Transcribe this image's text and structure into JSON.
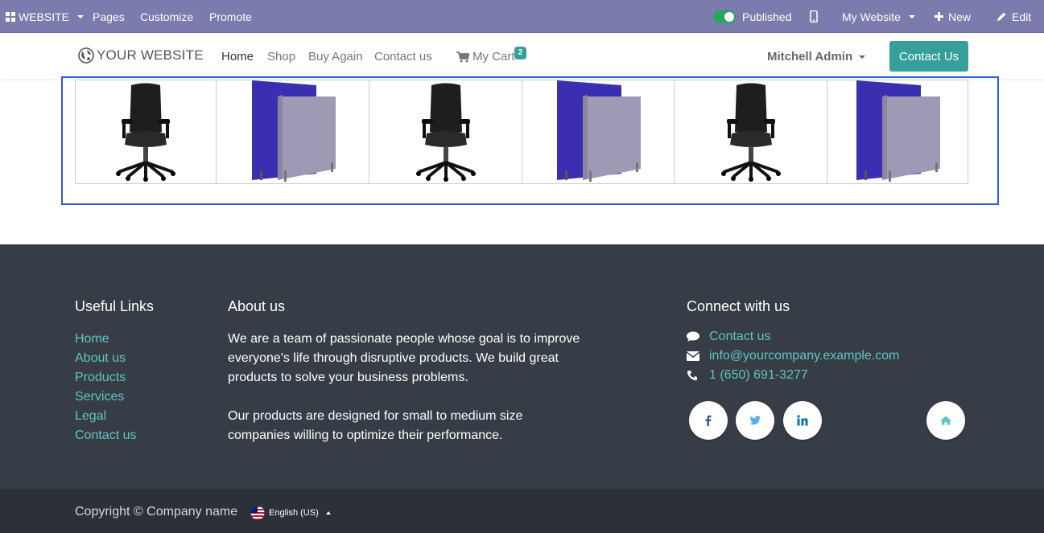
{
  "admin_bar": {
    "app_menu_label": "WEBSITE",
    "items": [
      "Pages",
      "Customize",
      "Promote"
    ],
    "published_label": "Published",
    "website_selector": "My Website",
    "new_label": "New",
    "edit_label": "Edit"
  },
  "header": {
    "logo_text": "YOUR WEBSITE",
    "nav": [
      "Home",
      "Shop",
      "Buy Again",
      "Contact us"
    ],
    "active_nav": "Home",
    "cart_label": "My Cart",
    "cart_count": "2",
    "user_name": "Mitchell Admin",
    "contact_button": "Contact Us"
  },
  "products": {
    "items": [
      {
        "image": "office-chair"
      },
      {
        "image": "office-partition"
      },
      {
        "image": "office-chair"
      },
      {
        "image": "office-partition"
      },
      {
        "image": "office-chair"
      },
      {
        "image": "office-partition"
      }
    ]
  },
  "footer": {
    "useful_links_title": "Useful Links",
    "useful_links": [
      "Home",
      "About us",
      "Products",
      "Services",
      "Legal",
      "Contact us"
    ],
    "about_title": "About us",
    "about_p1": "We are a team of passionate people whose goal is to improve everyone's life through disruptive products. We build great products to solve your business problems.",
    "about_p2": "Our products are designed for small to medium size companies willing to optimize their performance.",
    "connect_title": "Connect with us",
    "contact_link": "Contact us",
    "email": "info@yourcompany.example.com",
    "phone": "1 (650) 691-3277",
    "social": [
      "facebook-icon",
      "twitter-icon",
      "linkedin-icon",
      "home-icon"
    ],
    "copyright": "Copyright © Company name",
    "language": "English (US)"
  },
  "colors": {
    "admin_bar": "#7c7bad",
    "accent": "#35a09a",
    "footer_bg": "#373d46",
    "link": "#5fc5c0",
    "selection_outline": "#2e5bd8"
  }
}
